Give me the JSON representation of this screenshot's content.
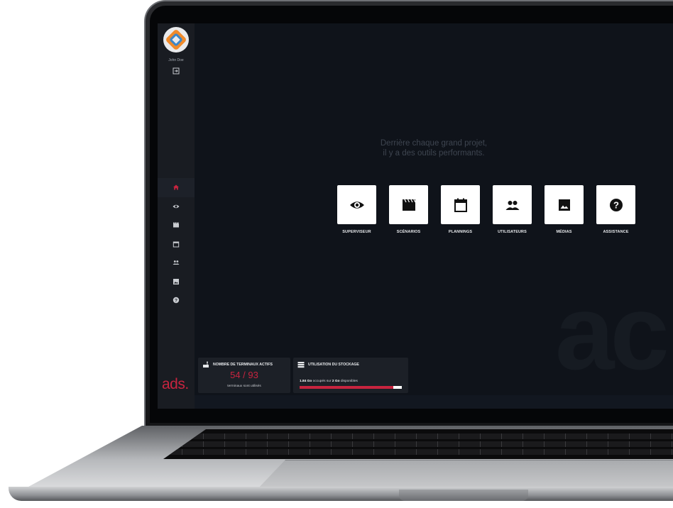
{
  "user": {
    "name": "John Doe"
  },
  "brand": {
    "logo_text": "ads."
  },
  "sidebar": {
    "items": [
      {
        "icon": "home-icon",
        "active": true
      },
      {
        "icon": "eye-icon",
        "active": false
      },
      {
        "icon": "clapperboard-icon",
        "active": false
      },
      {
        "icon": "calendar-icon",
        "active": false
      },
      {
        "icon": "users-icon",
        "active": false
      },
      {
        "icon": "image-icon",
        "active": false
      },
      {
        "icon": "help-icon",
        "active": false
      }
    ]
  },
  "main": {
    "tagline_line1": "Derrière chaque grand projet,",
    "tagline_line2": "il y a des outils performants.",
    "watermark": "ac",
    "tiles": [
      {
        "label": "SUPERVISEUR",
        "icon": "eye-icon"
      },
      {
        "label": "SCÉNARIOS",
        "icon": "clapperboard-icon"
      },
      {
        "label": "PLANNINGS",
        "icon": "calendar-icon"
      },
      {
        "label": "UTILISATEURS",
        "icon": "users-icon"
      },
      {
        "label": "MÉDIAS",
        "icon": "image-icon"
      },
      {
        "label": "ASSISTANCE",
        "icon": "help-icon"
      }
    ]
  },
  "widgets": {
    "terminals": {
      "title": "NOMBRE DE TERMINAUX ACTIFS",
      "count": "54 / 93",
      "note": "terminaux sont utilisés"
    },
    "storage": {
      "title": "UTILISATION DU STOCKAGE",
      "used": "1.84 Go",
      "mid_text": " occupés sur ",
      "total": "2 Go",
      "end_text": " disponibles",
      "fraction": 0.92
    }
  },
  "colors": {
    "accent": "#c8243f",
    "screen_bg": "#0f131a",
    "sidebar_bg": "#191c22",
    "tile_bg": "#ffffff"
  }
}
